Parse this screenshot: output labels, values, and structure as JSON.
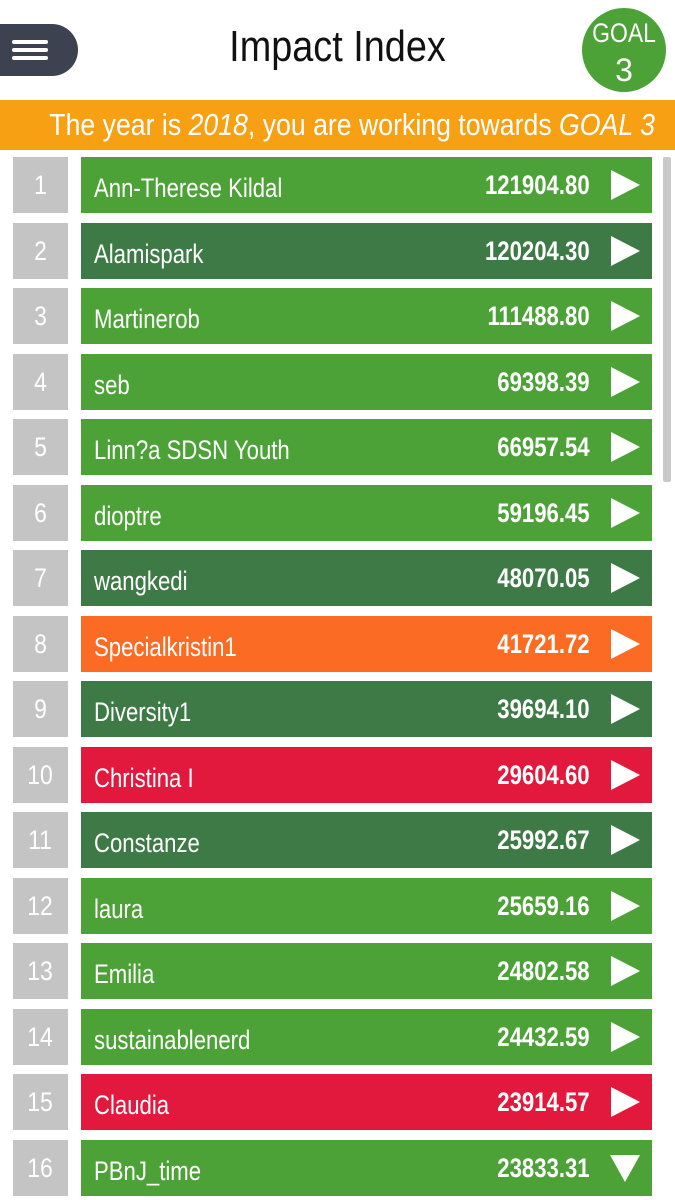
{
  "header": {
    "title": "Impact Index",
    "goal_badge": {
      "word": "GOAL",
      "number": "3"
    }
  },
  "banner": {
    "prefix": "The year is ",
    "year": "2018",
    "middle": ", you are working towards ",
    "goal": "GOAL 3"
  },
  "colors": {
    "green": "#4ca137",
    "dark_green": "#3e7a45",
    "orange": "#fc6b24",
    "red": "#e3183d",
    "rank_grey": "#c4c4c4",
    "banner_orange": "#f8a013"
  },
  "rows": [
    {
      "rank": "1",
      "name": "Ann-Therese Kildal",
      "score": "121904.80",
      "color": "#4ca137",
      "icon": "play-arrow-icon"
    },
    {
      "rank": "2",
      "name": "Alamispark",
      "score": "120204.30",
      "color": "#3e7a45",
      "icon": "play-arrow-icon"
    },
    {
      "rank": "3",
      "name": "Martinerob",
      "score": "111488.80",
      "color": "#4ca137",
      "icon": "play-arrow-icon"
    },
    {
      "rank": "4",
      "name": "seb",
      "score": "69398.39",
      "color": "#4ca137",
      "icon": "play-arrow-icon"
    },
    {
      "rank": "5",
      "name": "Linn?a SDSN Youth",
      "score": "66957.54",
      "color": "#4ca137",
      "icon": "play-arrow-icon"
    },
    {
      "rank": "6",
      "name": "dioptre",
      "score": "59196.45",
      "color": "#4ca137",
      "icon": "play-arrow-icon"
    },
    {
      "rank": "7",
      "name": "wangkedi",
      "score": "48070.05",
      "color": "#3e7a45",
      "icon": "play-arrow-icon"
    },
    {
      "rank": "8",
      "name": "Specialkristin1",
      "score": "41721.72",
      "color": "#fc6b24",
      "icon": "play-arrow-icon"
    },
    {
      "rank": "9",
      "name": "Diversity1",
      "score": "39694.10",
      "color": "#3e7a45",
      "icon": "play-arrow-icon"
    },
    {
      "rank": "10",
      "name": "Christina I",
      "score": "29604.60",
      "color": "#e3183d",
      "icon": "play-arrow-icon"
    },
    {
      "rank": "11",
      "name": "Constanze",
      "score": "25992.67",
      "color": "#3e7a45",
      "icon": "play-arrow-icon"
    },
    {
      "rank": "12",
      "name": "laura",
      "score": "25659.16",
      "color": "#4ca137",
      "icon": "play-arrow-icon"
    },
    {
      "rank": "13",
      "name": "Emilia",
      "score": "24802.58",
      "color": "#4ca137",
      "icon": "play-arrow-icon"
    },
    {
      "rank": "14",
      "name": "sustainablenerd",
      "score": "24432.59",
      "color": "#4ca137",
      "icon": "play-arrow-icon"
    },
    {
      "rank": "15",
      "name": "Claudia",
      "score": "23914.57",
      "color": "#e3183d",
      "icon": "play-arrow-icon"
    },
    {
      "rank": "16",
      "name": "PBnJ_time",
      "score": "23833.31",
      "color": "#4ca137",
      "icon": "down-arrow-icon"
    }
  ]
}
